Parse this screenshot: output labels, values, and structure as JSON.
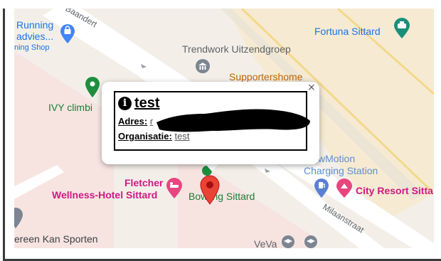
{
  "map": {
    "streets": [
      "Baandert",
      "Milaanstraat"
    ],
    "pois": [
      {
        "name_line1": "Running",
        "name_line2": "advies...",
        "name_line3": "ning Shop",
        "category": "shop"
      },
      {
        "name": "Fortuna Sittard",
        "category": "stadium"
      },
      {
        "name": "Trendwork Uitzendgroep",
        "category": "office"
      },
      {
        "name": "Supportershome",
        "category": "venue"
      },
      {
        "name": "IVY climbi",
        "category": "sports"
      },
      {
        "name_line1": "wMotion",
        "name_line2": "Charging Station",
        "category": "ev-charging"
      },
      {
        "name": "City Resort Sitta",
        "category": "hotel"
      },
      {
        "name_line1": "Fletcher",
        "name_line2": "Wellness-Hotel Sittard",
        "category": "hotel"
      },
      {
        "name": "Bowling Sittard",
        "category": "bowling"
      },
      {
        "name": "ereen Kan Sporten",
        "category": "sports"
      },
      {
        "name": "VeVa",
        "category": "school"
      }
    ],
    "colors": {
      "background": "#f3efe8",
      "road": "#ffffff",
      "blue": "#1a73e8",
      "green": "#188038",
      "pink": "#d01884",
      "orange": "#c26401",
      "marker": "#ea4335"
    }
  },
  "popup": {
    "title": "test",
    "address_label": "Adres:",
    "address_value": "r",
    "organisation_label": "Organisatie:",
    "organisation_value": "test",
    "close_symbol": "×",
    "info_symbol": "i"
  }
}
